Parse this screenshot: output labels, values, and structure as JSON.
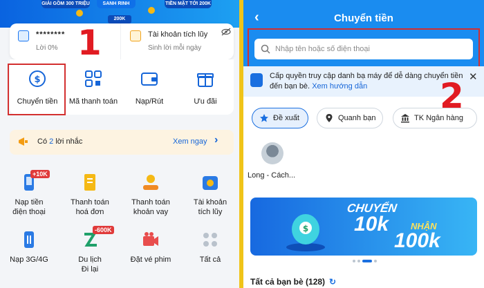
{
  "colors": {
    "divider": "#f0c419",
    "brand": "#1a8cf0",
    "highlight": "#d32f2f",
    "accent_number": "#e11b22"
  },
  "left": {
    "banner": {
      "chip_left": "GIẢI GỒM 300 TRIỆU",
      "chip_center": "SANH RINH",
      "chip_value": "200K",
      "chip_right": "TIỀN MẶT TỚI 200K"
    },
    "wallet": {
      "balance_masked": "********",
      "interest": "Lời 0%",
      "savings_title": "Tài khoản tích lũy",
      "savings_sub": "Sinh lời mỗi ngày",
      "hide_icon": "eye-off-icon"
    },
    "step_number": "1",
    "quick_actions": [
      {
        "label": "Chuyển tiền",
        "icon": "transfer-icon"
      },
      {
        "label": "Mã thanh toán",
        "icon": "qr-code-icon"
      },
      {
        "label": "Nạp/Rút",
        "icon": "wallet-icon"
      },
      {
        "label": "Ưu đãi",
        "icon": "gift-icon"
      }
    ],
    "reminder": {
      "prefix": "Có",
      "count": "2",
      "suffix": "lời nhắc",
      "action": "Xem ngay",
      "icon": "megaphone-icon"
    },
    "services": [
      {
        "line1": "Nạp tiền",
        "line2": "điện thoại",
        "icon": "phone-topup-icon",
        "tag": "+10K"
      },
      {
        "line1": "Thanh toán",
        "line2": "hoá đơn",
        "icon": "bill-icon",
        "tag": ""
      },
      {
        "line1": "Thanh toán",
        "line2": "khoản vay",
        "icon": "loan-icon",
        "tag": ""
      },
      {
        "line1": "Tài khoản",
        "line2": "tích lũy",
        "icon": "savings-icon",
        "tag": ""
      },
      {
        "line1": "Nạp 3G/4G",
        "line2": "",
        "icon": "data-icon",
        "tag": ""
      },
      {
        "line1": "Du lịch",
        "line2": "Đi lại",
        "icon": "travel-icon",
        "tag": "-600K"
      },
      {
        "line1": "Đặt vé phim",
        "line2": "",
        "icon": "movie-icon",
        "tag": ""
      },
      {
        "line1": "Tất cả",
        "line2": "",
        "icon": "grid-icon",
        "tag": ""
      }
    ]
  },
  "right": {
    "title": "Chuyển tiền",
    "back_icon": "back-arrow-icon",
    "search": {
      "placeholder": "Nhập tên hoặc số điện thoại"
    },
    "step_number": "2",
    "permission": {
      "text": "Cấp quyền truy cập danh bạ máy để dễ dàng chuyển tiền đến bạn bè.",
      "link": "Xem hướng dẫn"
    },
    "chips": [
      {
        "label": "Đề xuất",
        "icon": "star-icon",
        "selected": true
      },
      {
        "label": "Quanh bạn",
        "icon": "location-pin-icon",
        "selected": false
      },
      {
        "label": "TK Ngân hàng",
        "icon": "bank-icon",
        "selected": false
      }
    ],
    "contacts": [
      {
        "name": "Long - Cách..."
      }
    ],
    "promo": {
      "line1": "CHUYỂN",
      "line2": "10k",
      "line3": "NHẬN",
      "line4": "100k"
    },
    "friends": {
      "label": "Tất cả bạn bè (128)"
    }
  }
}
